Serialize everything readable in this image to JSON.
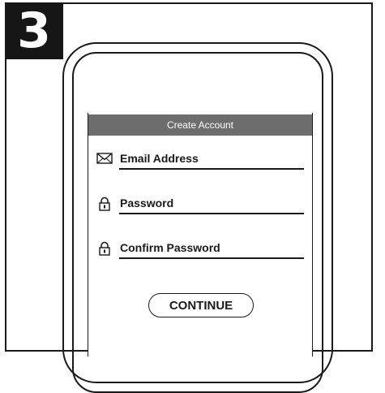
{
  "step": {
    "number": "3"
  },
  "screen": {
    "header_title": "Create Account",
    "fields": [
      {
        "icon": "envelope-icon",
        "label": "Email Address"
      },
      {
        "icon": "padlock-icon",
        "label": "Password"
      },
      {
        "icon": "padlock-icon",
        "label": "Confirm Password"
      }
    ],
    "continue_label": "CONTINUE"
  },
  "colors": {
    "header_bg": "#6d6d6d",
    "ink": "#1a1a1a",
    "badge_bg": "#161616"
  }
}
